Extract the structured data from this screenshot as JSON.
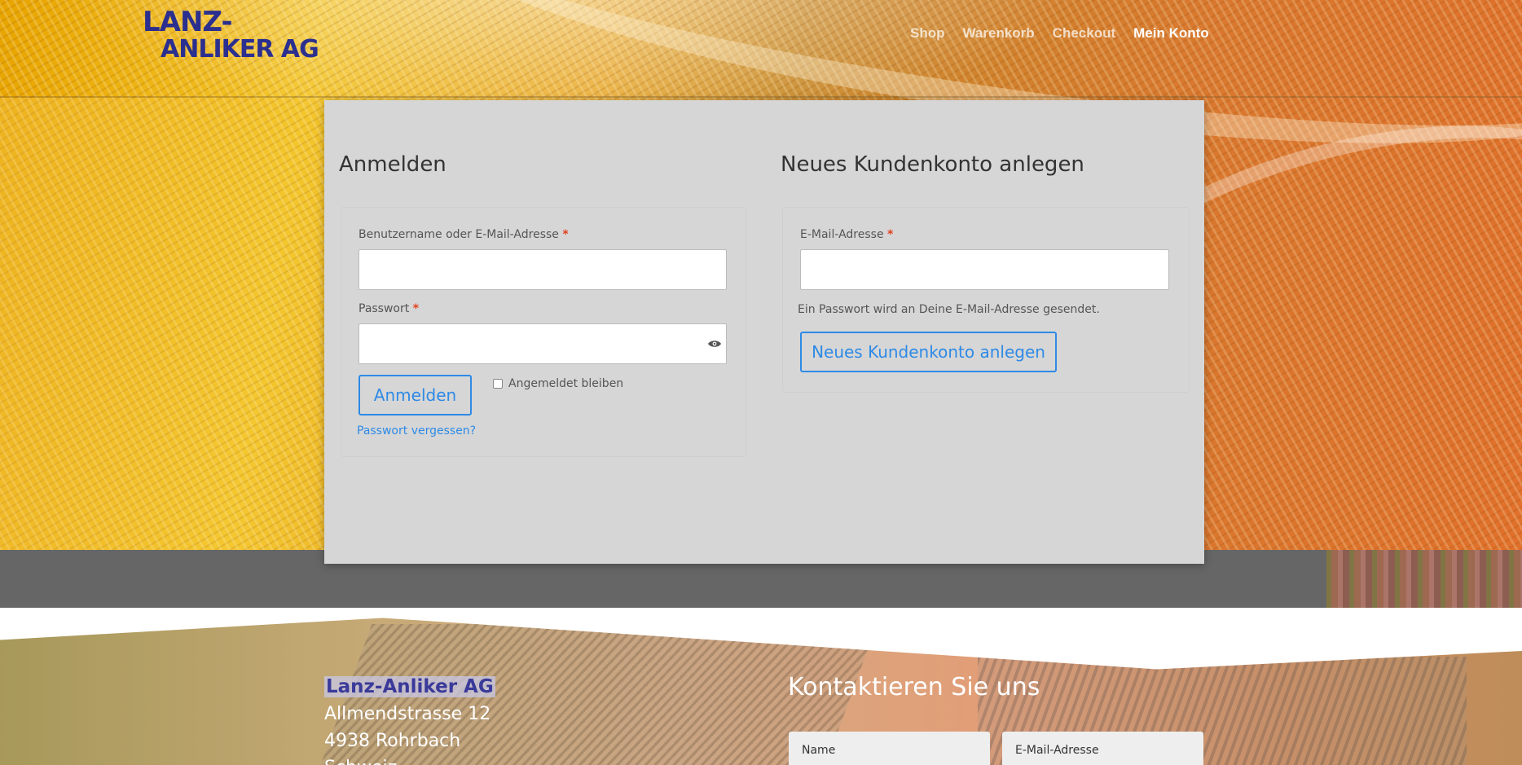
{
  "brand": {
    "logo_line1": "LANZ-",
    "logo_line2": "ANLIKER AG",
    "logo_color": "#2b2f8f"
  },
  "nav": {
    "items": [
      {
        "label": "Shop",
        "active": false
      },
      {
        "label": "Warenkorb",
        "active": false
      },
      {
        "label": "Checkout",
        "active": false
      },
      {
        "label": "Mein Konto",
        "active": true
      }
    ]
  },
  "login": {
    "title": "Anmelden",
    "username_label": "Benutzername oder E-Mail-Adresse",
    "username_value": "",
    "password_label": "Passwort",
    "password_value": "",
    "required_marker": "*",
    "submit_label": "Anmelden",
    "remember_label": "Angemeldet bleiben",
    "remember_checked": false,
    "forgot_link": "Passwort vergessen?"
  },
  "register": {
    "title": "Neues Kundenkonto anlegen",
    "email_label": "E-Mail-Adresse",
    "email_value": "",
    "required_marker": "*",
    "note": "Ein Passwort wird an Deine E-Mail-Adresse gesendet.",
    "submit_label": "Neues Kundenkonto anlegen"
  },
  "footer": {
    "company": "Lanz-Anliker AG",
    "street": "Allmendstrasse 12",
    "city": "4938 Rohrbach",
    "country_partial": "Schweiz",
    "contact_title": "Kontaktieren Sie uns",
    "name_placeholder": "Name",
    "email_placeholder": "E-Mail-Adresse"
  },
  "colors": {
    "accent": "#2e8ae6",
    "required": "#e2401c",
    "card_bg": "#d6d6d6",
    "band_gray": "#666666"
  }
}
